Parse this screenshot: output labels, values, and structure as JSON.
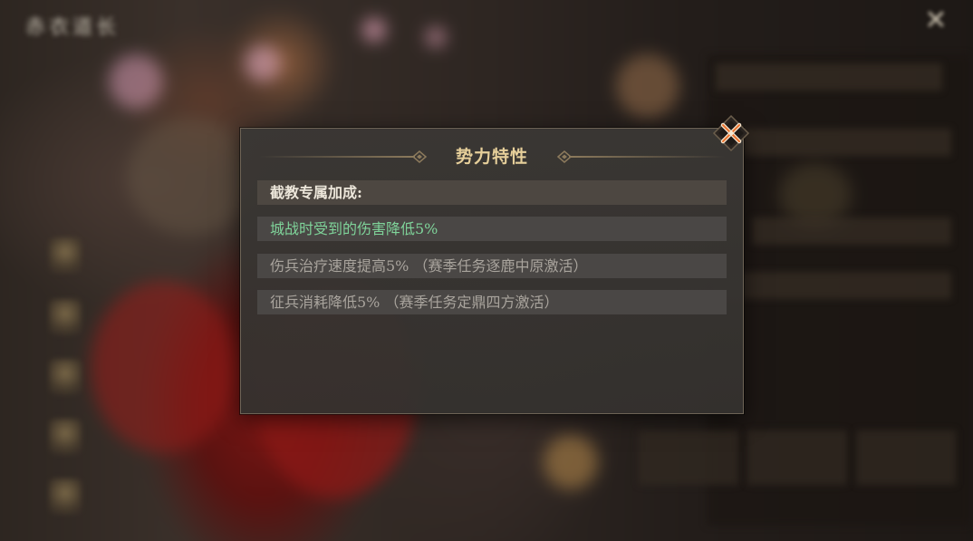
{
  "background": {
    "title": "赤衣道长",
    "close_glyph": "✕"
  },
  "dialog": {
    "title": "势力特性",
    "section_header": "截教专属加成:",
    "items": [
      {
        "text": "城战时受到的伤害降低5%",
        "active": true
      },
      {
        "text": "伤兵治疗速度提高5% （赛季任务逐鹿中原激活）",
        "active": false
      },
      {
        "text": "征兵消耗降低5% （赛季任务定鼎四方激活）",
        "active": false
      }
    ]
  },
  "colors": {
    "active_text": "#7fd49a",
    "inactive_text": "#a9a49d",
    "title_gold": "#e6cf9a",
    "close_accent": "#e8722e"
  },
  "icons": {
    "close": "close-icon",
    "header_ornament": "ornament-icon"
  }
}
